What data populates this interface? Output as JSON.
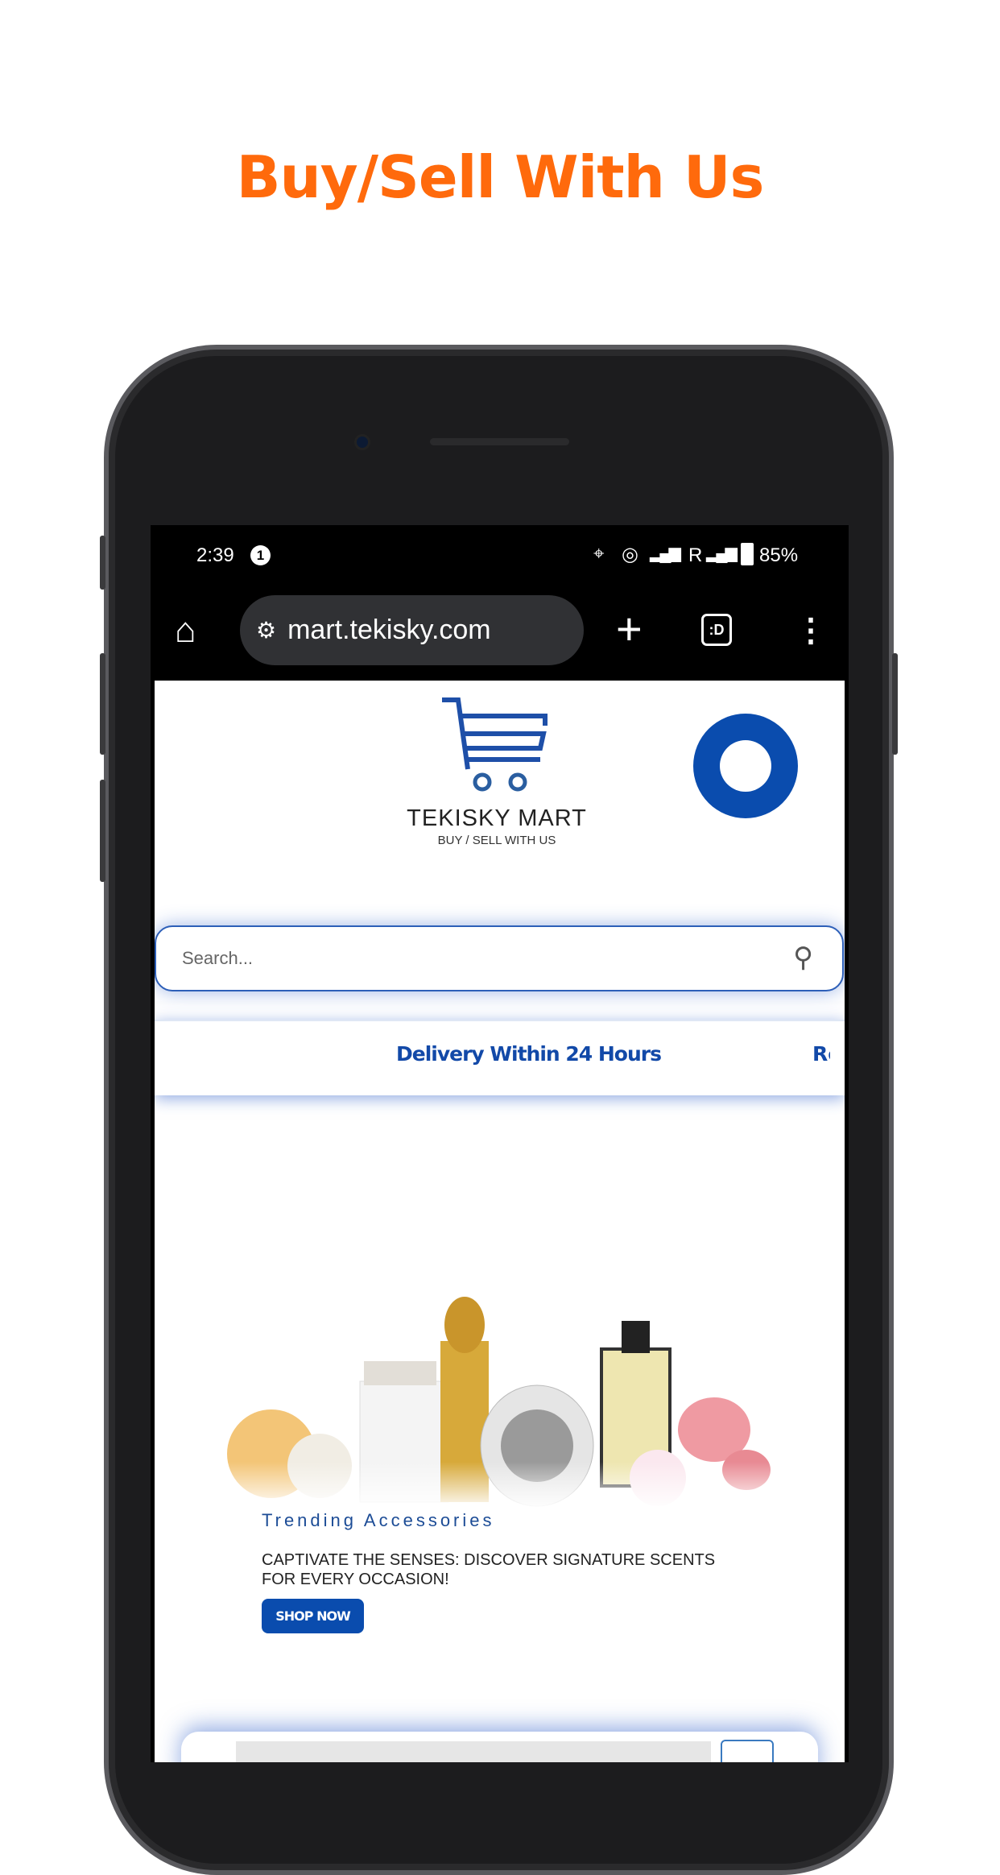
{
  "headline": "Buy/Sell With Us",
  "status_bar": {
    "time": "2:39",
    "notification_count": "1",
    "carrier": "R",
    "battery": "85%"
  },
  "browser": {
    "url": "mart.tekisky.com",
    "icons": [
      "home-icon",
      "site-settings-icon",
      "new-tab-icon",
      "tab-switcher-icon",
      "more-menu-icon"
    ],
    "tab_label": ":D"
  },
  "site": {
    "brand": "TEKISKY MART",
    "tagline": "BUY / SELL WITH US",
    "search_placeholder": "Search...",
    "marquee": [
      "Delivery Within 24 Hours",
      "Re"
    ],
    "hero": {
      "kicker": "Trending Accessories",
      "headline_line1": "CAPTIVATE THE SENSES: DISCOVER SIGNATURE SCENTS",
      "headline_line2": "FOR EVERY OCCASION!",
      "cta": "SHOP NOW"
    },
    "colors": {
      "brand_blue": "#0a4cae",
      "accent_orange": "#ff6a0c"
    }
  }
}
